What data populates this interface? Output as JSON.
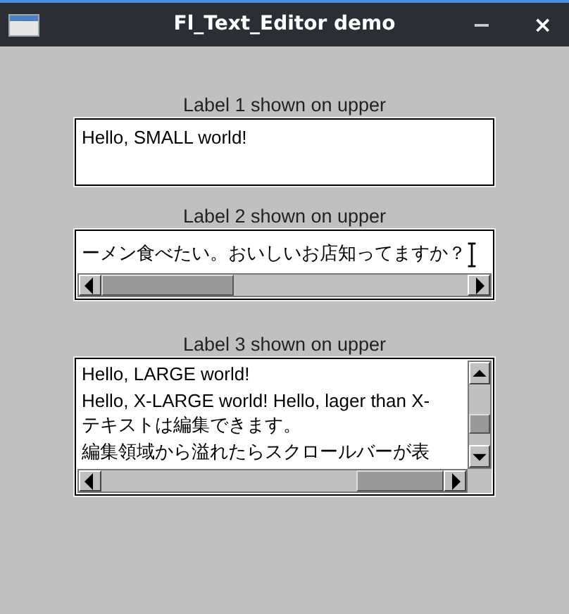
{
  "window": {
    "title": "Fl_Text_Editor demo",
    "controls": [
      {
        "kind": "minimize",
        "glyph": "−"
      },
      {
        "kind": "close",
        "glyph": "×"
      }
    ]
  },
  "editors": [
    {
      "label": "Label 1 shown on upper",
      "kind": "plain",
      "cursor": false,
      "lines": [
        "Hello, SMALL world!"
      ]
    },
    {
      "label": "Label 2 shown on upper",
      "kind": "hscroll",
      "cursor": true,
      "lines": [
        "ーメン食べたい。おいしいお店知ってますか？"
      ]
    },
    {
      "label": "Label 3 shown on upper",
      "kind": "both",
      "cursor": false,
      "lines": [
        "Hello, LARGE world!",
        "Hello, X-LARGE world! Hello, lager than X-",
        "テキストは編集できます。",
        "編集領域から溢れたらスクロールバーが表"
      ]
    }
  ]
}
